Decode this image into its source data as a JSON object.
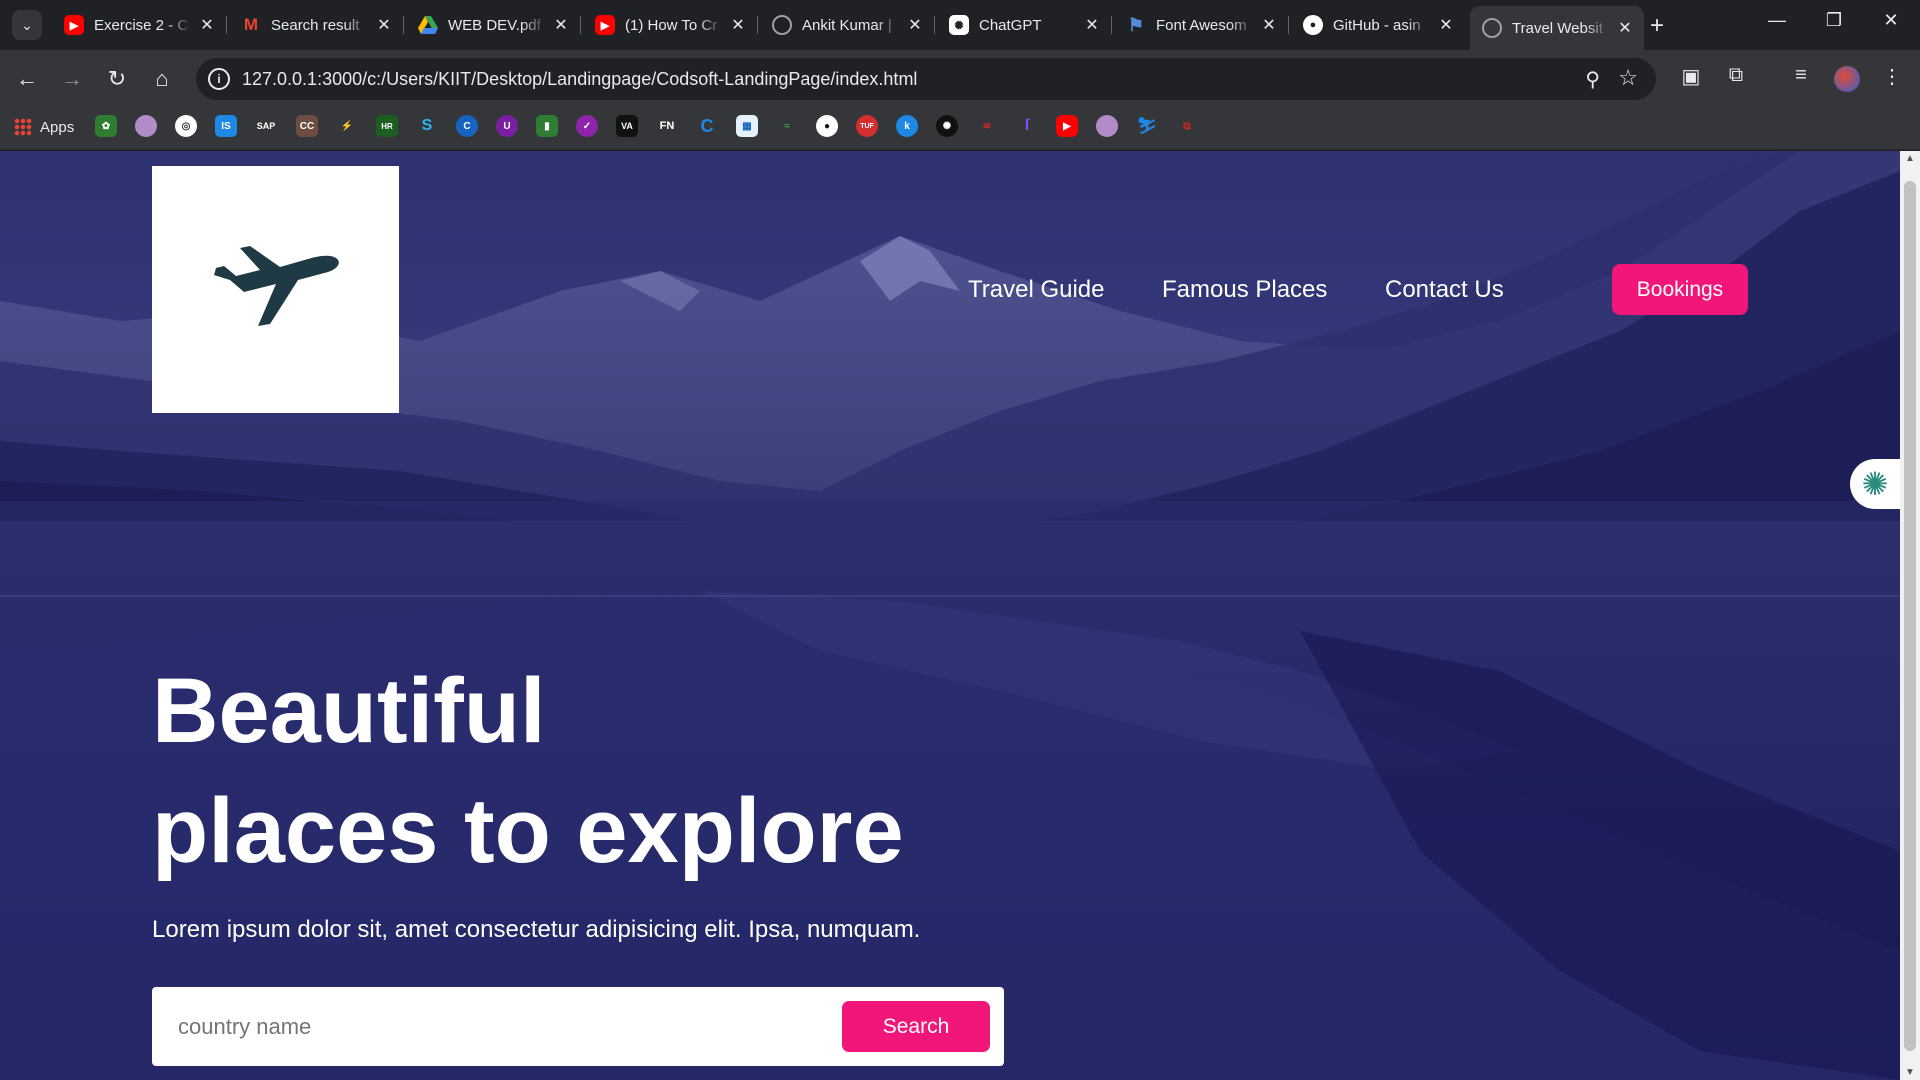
{
  "browser": {
    "tabs": [
      {
        "title": "Exercise 2 - C",
        "favicon": "youtube-icon",
        "color": "#ff0000"
      },
      {
        "title": "Search result",
        "favicon": "gmail-icon",
        "color": "#ea4335"
      },
      {
        "title": "WEB DEV.pdf",
        "favicon": "google-drive-icon",
        "color": "#fbbc04"
      },
      {
        "title": "(1) How To Cr",
        "favicon": "youtube-icon",
        "color": "#ff0000"
      },
      {
        "title": "Ankit Kumar |",
        "favicon": "globe-icon",
        "color": "#9aa0a6"
      },
      {
        "title": "ChatGPT",
        "favicon": "chatgpt-icon",
        "color": "#ffffff"
      },
      {
        "title": "Font Awesom",
        "favicon": "font-awesome-icon",
        "color": "#538dd7"
      },
      {
        "title": "GitHub - asin",
        "favicon": "github-icon",
        "color": "#ffffff"
      },
      {
        "title": "Travel Websit",
        "favicon": "globe-icon",
        "color": "#9aa0a6",
        "active": true
      }
    ],
    "url": "127.0.0.1:3000/c:/Users/KIIT/Desktop/Landingpage/Codsoft-LandingPage/index.html",
    "bookmarks_apps_label": "Apps",
    "accent": "#35363a"
  },
  "site": {
    "logo_icon": "airplane-icon",
    "nav": {
      "travel_guide": "Travel Guide",
      "famous_places": "Famous Places",
      "contact_us": "Contact Us",
      "bookings": "Bookings"
    },
    "hero": {
      "headline_line1": "Beautiful",
      "headline_line2": "places to explore",
      "subtitle": "Lorem ipsum dolor sit, amet consectetur adipisicing elit. Ipsa, numquam."
    },
    "search": {
      "placeholder": "country name",
      "button": "Search"
    },
    "colors": {
      "accent_pink": "#f2167b",
      "hero_tint": "#2b2d6e"
    }
  }
}
